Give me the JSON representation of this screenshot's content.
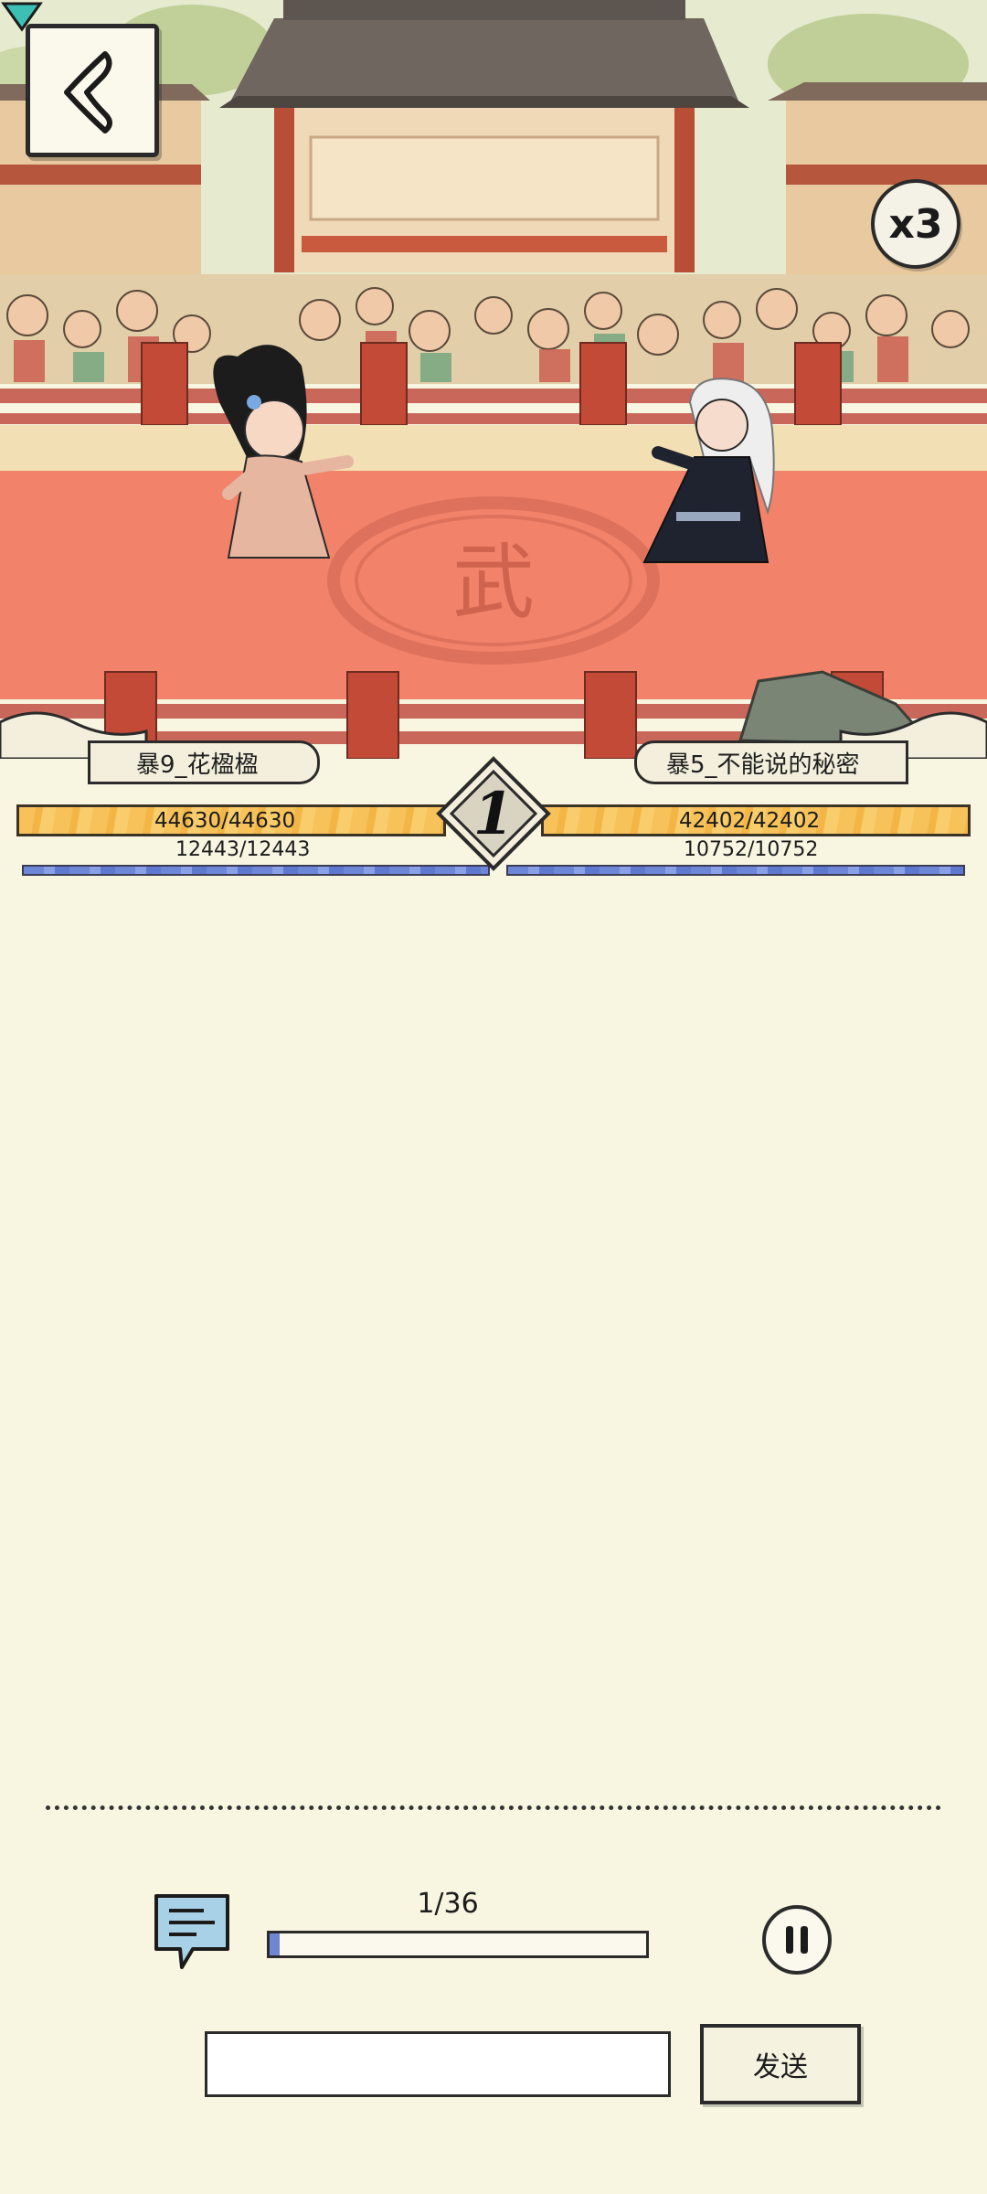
{
  "arena": {
    "speed_label": "x3",
    "round_number": "1"
  },
  "left_fighter": {
    "name": "暴9_花楹楹",
    "hp_text": "44630/44630",
    "mp_text": "12443/12443"
  },
  "right_fighter": {
    "name": "暴5_不能说的秘密",
    "hp_text": "42402/42402",
    "mp_text": "10752/10752"
  },
  "playback": {
    "progress_text": "1/36",
    "progress_fraction": 0.0278
  },
  "chat": {
    "input_value": "",
    "send_label": "发送"
  },
  "colors": {
    "hp": "#f7c25a",
    "mp": "#6d86d8",
    "floor": "#f2836a",
    "background": "#f8f5e1"
  },
  "icons": {
    "back": "back-arrow-icon",
    "chat": "chat-bubble-icon",
    "pause": "pause-icon",
    "target": "target-marker-icon"
  }
}
